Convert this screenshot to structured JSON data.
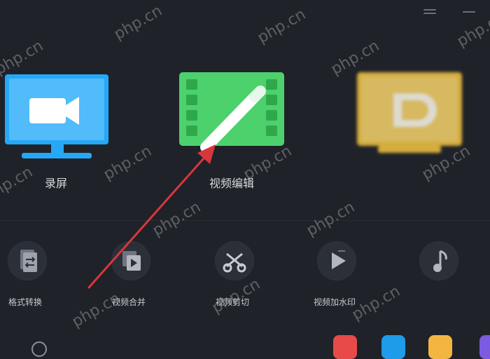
{
  "features": [
    {
      "label": "录屏",
      "icon": "monitor-camera-icon",
      "color": "#25a8f5"
    },
    {
      "label": "视频编辑",
      "icon": "film-pen-icon",
      "color": "#4cd16c"
    },
    {
      "label": "",
      "icon": "monitor-logo-icon",
      "color": "#f5c542"
    }
  ],
  "tools": [
    {
      "label": "格式转换",
      "icon": "format-convert-icon"
    },
    {
      "label": "视频合并",
      "icon": "video-merge-icon"
    },
    {
      "label": "视频剪切",
      "icon": "scissors-icon"
    },
    {
      "label": "视频加水印",
      "icon": "play-watermark-icon"
    },
    {
      "label": "",
      "icon": "music-note-icon"
    }
  ],
  "watermark": "php.cn",
  "annotation_color": "#d8363d",
  "bottom_apps": [
    {
      "icon": "red-app-icon",
      "color": "#e84a4a"
    },
    {
      "icon": "screen-app-icon",
      "color": "#1e9be9"
    },
    {
      "icon": "chart-app-icon",
      "color": "#f2b640"
    },
    {
      "icon": "purple-app-icon",
      "color": "#7b5be0"
    }
  ]
}
